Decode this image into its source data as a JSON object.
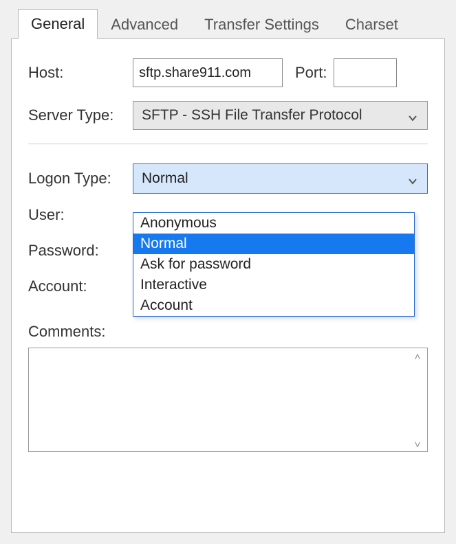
{
  "tabs": {
    "general": "General",
    "advanced": "Advanced",
    "transfer": "Transfer Settings",
    "charset": "Charset"
  },
  "labels": {
    "host": "Host:",
    "port": "Port:",
    "serverType": "Server Type:",
    "logonType": "Logon Type:",
    "user": "User:",
    "password": "Password:",
    "account": "Account:",
    "comments": "Comments:"
  },
  "values": {
    "host": "sftp.share911.com",
    "port": "",
    "serverType": "SFTP - SSH File Transfer Protocol",
    "logonType": "Normal",
    "comments": ""
  },
  "logonOptions": {
    "o0": "Anonymous",
    "o1": "Normal",
    "o2": "Ask for password",
    "o3": "Interactive",
    "o4": "Account"
  }
}
